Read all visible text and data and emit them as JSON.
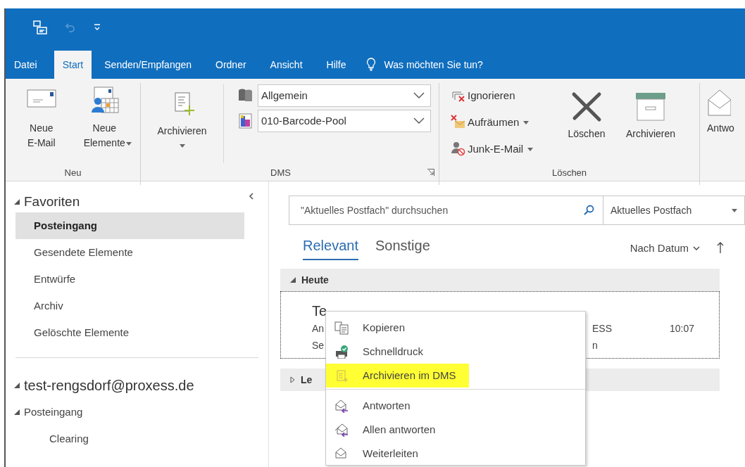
{
  "tabs": [
    {
      "label": "Datei",
      "selected": false
    },
    {
      "label": "Start",
      "selected": true
    },
    {
      "label": "Senden/Empfangen",
      "selected": false
    },
    {
      "label": "Ordner",
      "selected": false
    },
    {
      "label": "Ansicht",
      "selected": false
    },
    {
      "label": "Hilfe",
      "selected": false
    }
  ],
  "tell_me": "Was möchten Sie tun?",
  "ribbon": {
    "neu": {
      "label": "Neu",
      "buttons": [
        {
          "label": "Neue E-Mail",
          "dropdown": false
        },
        {
          "label": "Neue Elemente",
          "dropdown": true
        }
      ]
    },
    "dms": {
      "label": "DMS",
      "archive_button": {
        "label": "Archivieren",
        "dropdown": true
      },
      "combos": [
        {
          "value": "Allgemein"
        },
        {
          "value": "010-Barcode-Pool"
        }
      ]
    },
    "loeschen": {
      "label": "Löschen",
      "small_buttons": [
        {
          "label": "Ignorieren",
          "dropdown": false
        },
        {
          "label": "Aufräumen",
          "dropdown": true
        },
        {
          "label": "Junk-E-Mail",
          "dropdown": true
        }
      ],
      "large_buttons": [
        {
          "label": "Löschen"
        },
        {
          "label": "Archivieren"
        }
      ]
    },
    "next_group_button": "Antwo"
  },
  "navigation": {
    "favorites": {
      "label": "Favoriten",
      "expanded": true,
      "items": [
        {
          "label": "Posteingang",
          "selected": true
        },
        {
          "label": "Gesendete Elemente",
          "selected": false
        },
        {
          "label": "Entwürfe",
          "selected": false
        },
        {
          "label": "Archiv",
          "selected": false
        },
        {
          "label": "Gelöschte Elemente",
          "selected": false
        }
      ]
    },
    "accounts": [
      {
        "label": "test-rengsdorf@proxess.de",
        "expanded": true,
        "children": [
          {
            "label": "Posteingang",
            "expanded": true,
            "children": [
              {
                "label": "Clearing"
              }
            ]
          }
        ]
      }
    ]
  },
  "mail_list": {
    "search": {
      "placeholder": "\"Aktuelles Postfach\" durchsuchen",
      "scope": "Aktuelles Postfach"
    },
    "tabs": [
      {
        "label": "Relevant",
        "selected": true
      },
      {
        "label": "Sonstige",
        "selected": false
      }
    ],
    "sort": "Nach Datum",
    "groups": [
      {
        "label": "Heute",
        "expanded": true,
        "messages": [
          {
            "sender": "Te",
            "line_2_start": "An",
            "line_2_end": "ESS",
            "time": "10:07",
            "line_3_start": "Se",
            "line_3_end": "n"
          }
        ]
      },
      {
        "label": "Le",
        "expanded": false
      }
    ]
  },
  "context_menu": [
    {
      "label": "Kopieren",
      "kind": "copy",
      "highlighted": false,
      "separator_after": false
    },
    {
      "label": "Schnelldruck",
      "kind": "print",
      "highlighted": false,
      "separator_after": false
    },
    {
      "label": "Archivieren im DMS",
      "kind": "archive",
      "highlighted": true,
      "separator_after": true
    },
    {
      "label": "Antworten",
      "kind": "reply",
      "highlighted": false,
      "separator_after": false
    },
    {
      "label": "Allen antworten",
      "kind": "reply-all",
      "highlighted": false,
      "separator_after": false
    },
    {
      "label": "Weiterleiten",
      "kind": "forward",
      "highlighted": false,
      "separator_after": false
    }
  ]
}
